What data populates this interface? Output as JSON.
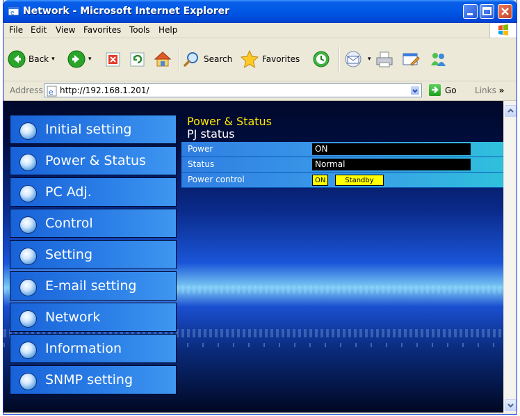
{
  "window": {
    "title": "Network - Microsoft Internet Explorer"
  },
  "menu": [
    "File",
    "Edit",
    "View",
    "Favorites",
    "Tools",
    "Help"
  ],
  "toolbar": {
    "back": "Back",
    "search": "Search",
    "favorites": "Favorites"
  },
  "address": {
    "label": "Address",
    "url": "http://192.168.1.201/",
    "go": "Go",
    "links": "Links"
  },
  "sidebar": {
    "items": [
      {
        "label": "Initial setting",
        "icon": "initial-setting-icon"
      },
      {
        "label": "Power & Status",
        "icon": "power-status-icon"
      },
      {
        "label": "PC Adj.",
        "icon": "pc-adjust-icon"
      },
      {
        "label": "Control",
        "icon": "control-icon"
      },
      {
        "label": "Setting",
        "icon": "setting-icon"
      },
      {
        "label": "E-mail setting",
        "icon": "email-icon"
      },
      {
        "label": "Network",
        "icon": "network-icon"
      },
      {
        "label": "Information",
        "icon": "information-icon"
      },
      {
        "label": "SNMP setting",
        "icon": "snmp-icon"
      }
    ]
  },
  "main": {
    "title": "Power & Status",
    "subtitle": "PJ status",
    "rows": {
      "power": {
        "label": "Power",
        "value": "ON"
      },
      "status": {
        "label": "Status",
        "value": "Normal"
      },
      "power_control": {
        "label": "Power control",
        "on": "ON",
        "standby": "Standby"
      }
    }
  },
  "colors": {
    "title_accent": "#ffe600",
    "button_yellow": "#ffff00",
    "xp_blue": "#0058e6"
  }
}
